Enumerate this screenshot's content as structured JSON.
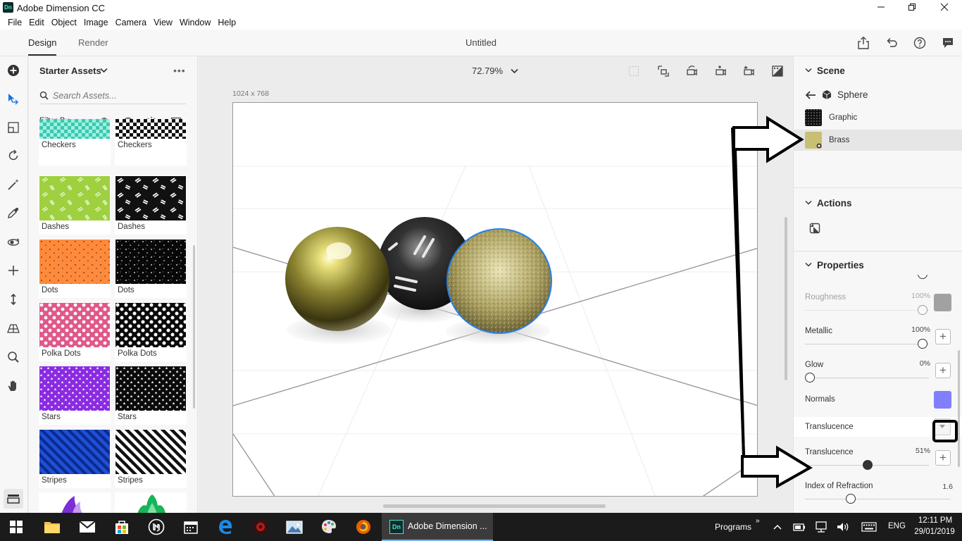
{
  "window": {
    "title": "Adobe Dimension CC",
    "logo_text": "Dn"
  },
  "menu": [
    "File",
    "Edit",
    "Object",
    "Image",
    "Camera",
    "View",
    "Window",
    "Help"
  ],
  "header": {
    "tabs": [
      "Design",
      "Render"
    ],
    "active_tab": "Design",
    "document_title": "Untitled"
  },
  "assets": {
    "title": "Starter Assets",
    "more": "•••",
    "search_placeholder": "Search Assets...",
    "filter_label": "Filter By",
    "filter_icons": [
      "model-filter-icon",
      "material-filter-icon",
      "light-filter-icon",
      "image-filter-icon"
    ],
    "items": [
      {
        "label": "Checkers",
        "pattern": "checkers-teal"
      },
      {
        "label": "Checkers",
        "pattern": "checkers-black"
      },
      {
        "label": "Dashes",
        "pattern": "dashes-green"
      },
      {
        "label": "Dashes",
        "pattern": "dashes-black"
      },
      {
        "label": "Dots",
        "pattern": "dots-orange"
      },
      {
        "label": "Dots",
        "pattern": "dots-black"
      },
      {
        "label": "Polka Dots",
        "pattern": "polka-pink"
      },
      {
        "label": "Polka Dots",
        "pattern": "polka-black"
      },
      {
        "label": "Stars",
        "pattern": "stars-purple"
      },
      {
        "label": "Stars",
        "pattern": "stars-black"
      },
      {
        "label": "Stripes",
        "pattern": "stripes-blue"
      },
      {
        "label": "Stripes",
        "pattern": "stripes-black"
      }
    ]
  },
  "viewport": {
    "zoom": "72.79%",
    "canvas_size": "1024 x 768"
  },
  "scene": {
    "title": "Scene",
    "object": "Sphere",
    "layers": [
      {
        "label": "Graphic",
        "selected": false
      },
      {
        "label": "Brass",
        "selected": true
      }
    ]
  },
  "actions": {
    "title": "Actions"
  },
  "properties": {
    "title": "Properties",
    "roughness": {
      "label": "Roughness",
      "value": "100%"
    },
    "metallic": {
      "label": "Metallic",
      "value": "100%"
    },
    "glow": {
      "label": "Glow",
      "value": "0%"
    },
    "normals": {
      "label": "Normals"
    },
    "translucence_section": {
      "label": "Translucence"
    },
    "translucence": {
      "label": "Translucence",
      "value": "51%"
    },
    "index_of_refraction": {
      "label": "Index of Refraction",
      "value": "1.6"
    }
  },
  "colors": {
    "accent_selected": "#2680eb",
    "normals_swatch": "#8080ff",
    "roughness_swatch": "#3a3a3a",
    "brass_swatch": "#c7bf72"
  },
  "taskbar": {
    "active_app": "Adobe Dimension ...",
    "programs": "Programs",
    "chevron": "»",
    "language": "ENG",
    "time": "12:11 PM",
    "date": "29/01/2019"
  }
}
